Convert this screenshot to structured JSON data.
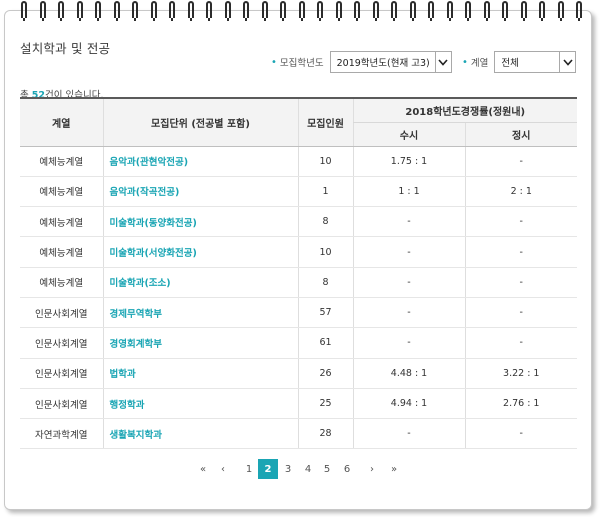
{
  "page": {
    "title": "설치학과 및 전공"
  },
  "filters": {
    "year_label": "모집학년도",
    "year_value": "2019학년도(현재 고3)",
    "field_label": "계열",
    "field_value": "전체"
  },
  "summary": {
    "prefix": "총 ",
    "count": "52",
    "suffix": "건이 있습니다."
  },
  "table": {
    "headers": {
      "field": "계열",
      "unit": "모집단위 (전공별 포함)",
      "quota": "모집인원",
      "competition": "2018학년도경쟁률(정원내)",
      "early": "수시",
      "regular": "정시"
    },
    "rows": [
      {
        "field": "예체능계열",
        "unit": "음악과(관현악전공)",
        "quota": "10",
        "early": "1.75 : 1",
        "regular": "-"
      },
      {
        "field": "예체능계열",
        "unit": "음악과(작곡전공)",
        "quota": "1",
        "early": "1 : 1",
        "regular": "2 : 1"
      },
      {
        "field": "예체능계열",
        "unit": "미술학과(동양화전공)",
        "quota": "8",
        "early": "-",
        "regular": "-"
      },
      {
        "field": "예체능계열",
        "unit": "미술학과(서양화전공)",
        "quota": "10",
        "early": "-",
        "regular": "-"
      },
      {
        "field": "예체능계열",
        "unit": "미술학과(조소)",
        "quota": "8",
        "early": "-",
        "regular": "-"
      },
      {
        "field": "인문사회계열",
        "unit": "경제무역학부",
        "quota": "57",
        "early": "-",
        "regular": "-"
      },
      {
        "field": "인문사회계열",
        "unit": "경영회계학부",
        "quota": "61",
        "early": "-",
        "regular": "-"
      },
      {
        "field": "인문사회계열",
        "unit": "법학과",
        "quota": "26",
        "early": "4.48 : 1",
        "regular": "3.22 : 1"
      },
      {
        "field": "인문사회계열",
        "unit": "행정학과",
        "quota": "25",
        "early": "4.94 : 1",
        "regular": "2.76 : 1"
      },
      {
        "field": "자연과학계열",
        "unit": "생활복지학과",
        "quota": "28",
        "early": "-",
        "regular": "-"
      }
    ]
  },
  "pagination": {
    "first": "«",
    "prev": "‹",
    "pages": [
      "1",
      "2",
      "3",
      "4",
      "5",
      "6"
    ],
    "current": "2",
    "next": "›",
    "last": "»"
  },
  "colors": {
    "accent": "#1aa5b4",
    "header_bg": "#f3f3f3",
    "border": "#5a5a5a"
  },
  "icons": {
    "binder": "binder-ring-icon",
    "dropdown": "chevron-down-icon"
  }
}
